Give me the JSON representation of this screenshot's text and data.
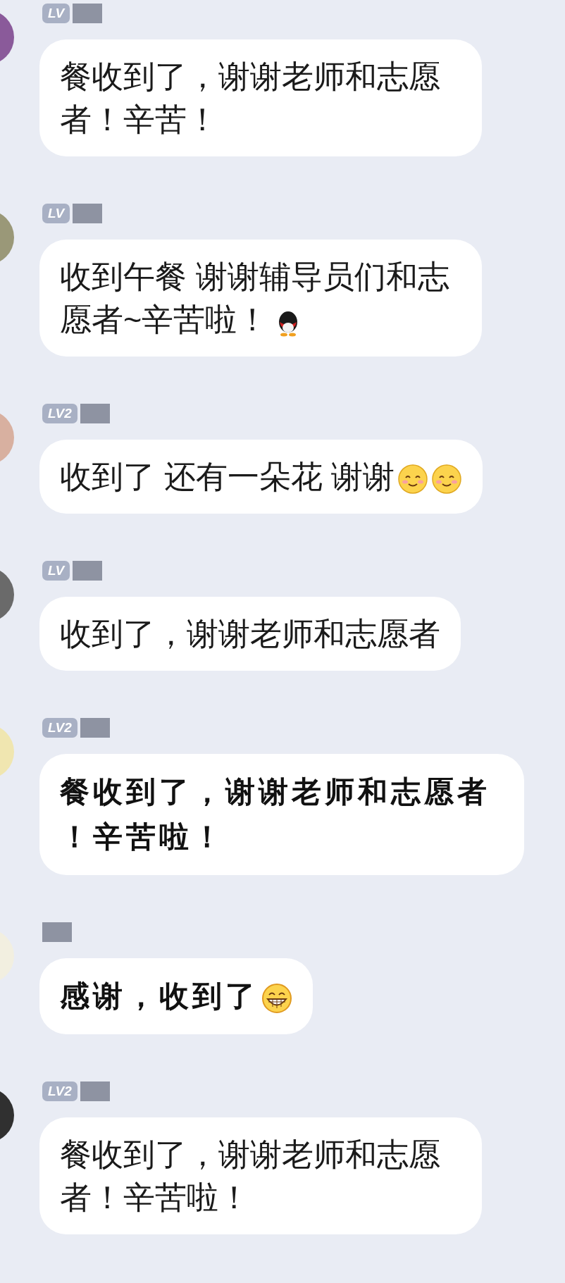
{
  "messages": [
    {
      "badge": "LV",
      "kind": "plain",
      "text": "餐收到了，谢谢老师和志愿者！辛苦！"
    },
    {
      "badge": "LV",
      "kind": "plain",
      "text": "收到午餐 谢谢辅导员们和志愿者~辛苦啦！",
      "emoji": [
        {
          "kind": "penguin"
        }
      ]
    },
    {
      "badge": "LV2",
      "kind": "plain",
      "text": "收到了 还有一朵花 谢谢",
      "emoji": [
        {
          "kind": "smile"
        },
        {
          "kind": "smile"
        }
      ]
    },
    {
      "badge": "LV",
      "kind": "plain",
      "text": "收到了，谢谢老师和志愿者"
    },
    {
      "badge": "LV2",
      "kind": "handwriting",
      "text": "餐收到了，谢谢老师和志愿者！辛苦啦！"
    },
    {
      "kind": "handwriting",
      "text": "感谢，收到了",
      "emoji": [
        {
          "kind": "grin"
        }
      ]
    },
    {
      "badge": "LV2",
      "kind": "plain",
      "text": "餐收到了，谢谢老师和志愿者！辛苦啦！"
    }
  ]
}
